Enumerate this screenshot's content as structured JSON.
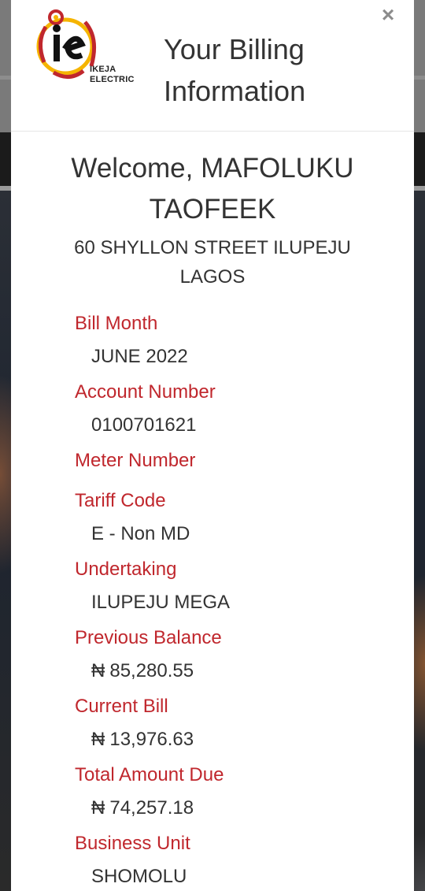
{
  "modal": {
    "title": "Your Billing Information",
    "close_symbol": "×",
    "logo": {
      "line1": "IKEJA",
      "line2": "ELECTRIC",
      "brand_color": "#c0272d",
      "accent_color": "#f5b400"
    }
  },
  "customer": {
    "welcome": "Welcome, MAFOLUKU TAOFEEK",
    "address": "60 SHYLLON STREET ILUPEJU LAGOS"
  },
  "billing": {
    "bill_month": {
      "label": "Bill Month",
      "value": "JUNE 2022"
    },
    "account_number": {
      "label": "Account Number",
      "value": "0100701621"
    },
    "meter_number": {
      "label": "Meter Number",
      "value": ""
    },
    "tariff_code": {
      "label": "Tariff Code",
      "value": "E - Non MD"
    },
    "undertaking": {
      "label": "Undertaking",
      "value": "ILUPEJU MEGA"
    },
    "previous_balance": {
      "label": "Previous Balance",
      "currency": "₦",
      "value": "85,280.55"
    },
    "current_bill": {
      "label": "Current Bill",
      "currency": "₦",
      "value": "13,976.63"
    },
    "total_amount_due": {
      "label": "Total Amount Due",
      "currency": "₦",
      "value": "74,257.18"
    },
    "business_unit": {
      "label": "Business Unit",
      "value": "SHOMOLU"
    }
  },
  "colors": {
    "label": "#c0272d",
    "text": "#333333"
  }
}
